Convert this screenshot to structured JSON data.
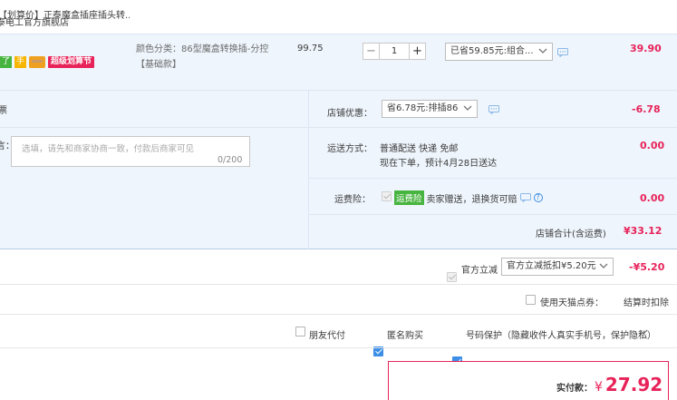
{
  "shop": {
    "name": "泰电工官方旗舰店"
  },
  "item": {
    "title": "【划算价】正泰魔盒插座插头转...",
    "tags": {
      "green": "了",
      "yellow": "手",
      "red": "超级划算节"
    },
    "spec_label": "颜色分类：86型魔盒转换插-分控",
    "spec_sub": "【基础款】",
    "unit_price": "99.75",
    "quantity": "1",
    "qty_minus": "−",
    "qty_plus": "+",
    "discount_select": "已省59.85元:组合...",
    "subtotal": "39.90"
  },
  "invoice": {
    "label": "票"
  },
  "message": {
    "label": "言：",
    "placeholder": "选填，请先和商家协商一致，付款后商家可见",
    "counter": "0/200"
  },
  "shop_discount": {
    "label": "店铺优惠：",
    "select": "省6.78元:排插86",
    "amount": "-6.78"
  },
  "shipping": {
    "label": "运送方式：",
    "method": "普通配送 快递 免邮",
    "eta": "现在下单，预计4月28日送达",
    "amount": "0.00"
  },
  "freight_insurance": {
    "label": "运费险：",
    "badge": "运费险",
    "text": "卖家赠送，退换货可赔",
    "help": "?",
    "amount": "0.00"
  },
  "shop_total": {
    "label": "店铺合计(含运费)",
    "amount": "¥33.12"
  },
  "official_discount": {
    "label": "官方立减",
    "select": "官方立减抵扣¥5.20元",
    "amount": "-¥5.20"
  },
  "tianmao_points": {
    "label": "使用天猫点券：",
    "note": "结算时扣除"
  },
  "options": {
    "friend_pay": "朋友代付",
    "anonymous": "匿名购买",
    "privacy": "号码保护（隐藏收件人真实手机号，保护隐私）"
  },
  "payment": {
    "label": "实付款：",
    "currency": "¥",
    "amount": "27.92"
  },
  "colors": {
    "accent_red": "#e8235a",
    "blue_bg": "#eef5fc",
    "border_blue": "#dbe7f3",
    "checkbox_blue": "#3c8ee6"
  }
}
